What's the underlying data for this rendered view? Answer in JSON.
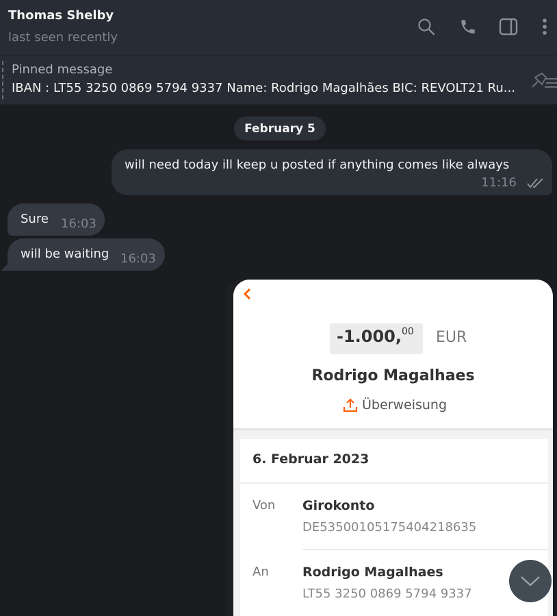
{
  "header": {
    "contact_name": "Thomas Shelby",
    "status": "last seen recently",
    "icons": [
      "search-icon",
      "phone-icon",
      "sidebar-toggle-icon",
      "more-vertical-icon"
    ]
  },
  "pinned": {
    "title": "Pinned message",
    "text": "IBAN : LT55 3250 0869 5794 9337 Name: Rodrigo Magalhães BIC: REVOLT21  Ru...",
    "icon": "pin-list-icon"
  },
  "chat": {
    "date_separator": "February 5",
    "messages": [
      {
        "direction": "outgoing",
        "text": "will need today ill keep u posted if anything comes like always",
        "time": "11:16",
        "status": "read"
      },
      {
        "direction": "incoming",
        "text": "Sure",
        "time": "16:03"
      },
      {
        "direction": "incoming",
        "text": "will be waiting",
        "time": "16:03"
      }
    ]
  },
  "screenshot": {
    "amount_main": "-1.000,",
    "amount_cents": "00",
    "currency": "EUR",
    "payee": "Rodrigo Magalhaes",
    "type": "Überweisung",
    "date": "6. Februar 2023",
    "from_label": "Von",
    "from_account": "Girokonto",
    "from_iban": "DE53500105175404218635",
    "to_label": "An",
    "to_name": "Rodrigo Magalhaes",
    "to_iban": "LT55 3250 0869 5794 9337",
    "accent": "#ff6200"
  },
  "scroll_button": {
    "icon": "chevron-down-icon"
  }
}
